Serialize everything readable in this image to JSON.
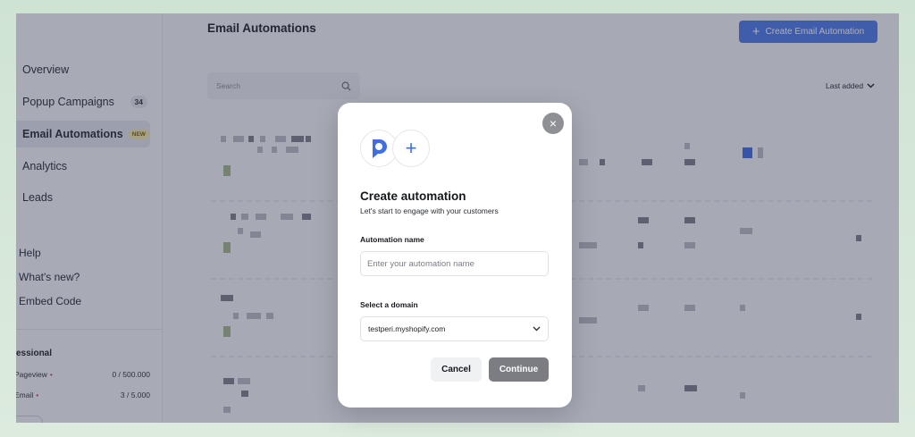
{
  "sidebar": {
    "items": [
      {
        "label": "Overview"
      },
      {
        "label": "Popup Campaigns",
        "count": "34"
      },
      {
        "label": "Email Automations",
        "badge": "NEW"
      },
      {
        "label": "Analytics"
      },
      {
        "label": "Leads"
      }
    ],
    "secondary": [
      {
        "label": "Help"
      },
      {
        "label": "What's new?"
      },
      {
        "label": "Embed Code"
      }
    ],
    "plan": {
      "title": "essional",
      "usage": [
        {
          "label": "Pageview",
          "value": "0 / 500.000"
        },
        {
          "label": "Email",
          "value": "3 / 5.000"
        }
      ]
    }
  },
  "header": {
    "title": "Email Automations",
    "create_label": "Create Email Automation",
    "create_icon": "plus-icon"
  },
  "list": {
    "search_placeholder": "Search",
    "sort_label": "Last added"
  },
  "modal": {
    "title": "Create automation",
    "subtitle": "Let's start to engage with your customers",
    "name_label": "Automation name",
    "name_placeholder": "Enter your automation name",
    "domain_label": "Select a domain",
    "domain_value": "testperi.myshopify.com",
    "cancel_label": "Cancel",
    "continue_label": "Continue",
    "close_glyph": "×",
    "plus_glyph": "+"
  },
  "colors": {
    "accent": "#4f7be8",
    "overlay": "#282c46",
    "continue_disabled": "#7b7d82"
  }
}
